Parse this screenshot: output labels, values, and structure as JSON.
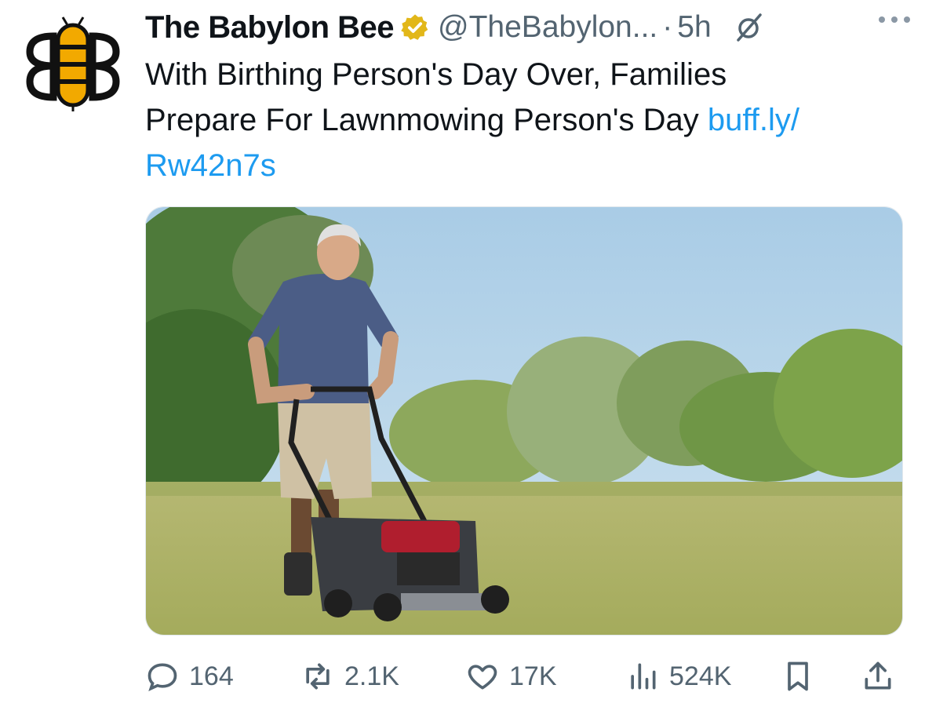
{
  "tweet": {
    "author": {
      "display_name": "The Babylon Bee",
      "handle": "@TheBabylon...",
      "avatar_icon": "bee-logo-icon",
      "verified_badge": "gold-verified-icon",
      "verified_color": "#e2b719"
    },
    "separator": "·",
    "timestamp": "5h",
    "text_line1": "With Birthing Person's Day Over, Families",
    "text_line2": "Prepare For Lawnmowing Person's Day ",
    "link_part1": "buff.ly/",
    "link_part2": "Rw42n7s",
    "link_color": "#1d9bf0",
    "media": {
      "image_icon": "photo-man-mowing-lawn"
    },
    "actions": {
      "replies": "164",
      "reposts": "2.1K",
      "likes": "17K",
      "views": "524K"
    }
  }
}
